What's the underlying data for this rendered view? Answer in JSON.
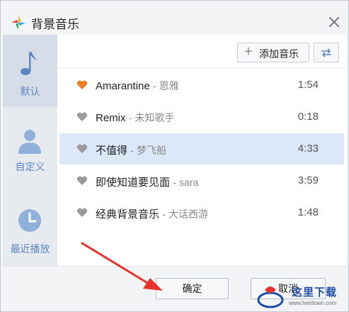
{
  "window": {
    "title": "背景音乐"
  },
  "sidebar": {
    "items": [
      {
        "label": "默认",
        "icon": "music-note-icon",
        "active": true
      },
      {
        "label": "自定义",
        "icon": "user-icon",
        "active": false
      },
      {
        "label": "最近播放",
        "icon": "clock-icon",
        "active": false
      }
    ]
  },
  "toolbar": {
    "add_label": "添加音乐",
    "add_icon": "plus-icon",
    "loop_icon": "loop-icon"
  },
  "songs": [
    {
      "title": "Amarantine",
      "artist": "恩雅",
      "separator": "-",
      "duration": "1:54",
      "favorite": true
    },
    {
      "title": "Remix",
      "artist": "未知歌手",
      "separator": "-",
      "duration": "0:18",
      "favorite": false
    },
    {
      "title": "不值得",
      "artist": "梦飞船",
      "separator": "-",
      "duration": "4:33",
      "favorite": false,
      "selected": true
    },
    {
      "title": "即使知道要见面",
      "artist": "sara",
      "separator": "-",
      "duration": "3:59",
      "favorite": false
    },
    {
      "title": "经典背景音乐",
      "artist": "大话西游",
      "separator": "-",
      "duration": "1:48",
      "favorite": false
    }
  ],
  "footer": {
    "ok_label": "确定",
    "cancel_label": "取消"
  },
  "watermark": {
    "text": "这里下载",
    "url": "www.herdown.com"
  },
  "colors": {
    "accent": "#5b86c1",
    "favorite": "#f07c2a",
    "heart_gray": "#9a9a9a",
    "selected_row": "#dce8f7",
    "arrow": "#e8332d"
  }
}
